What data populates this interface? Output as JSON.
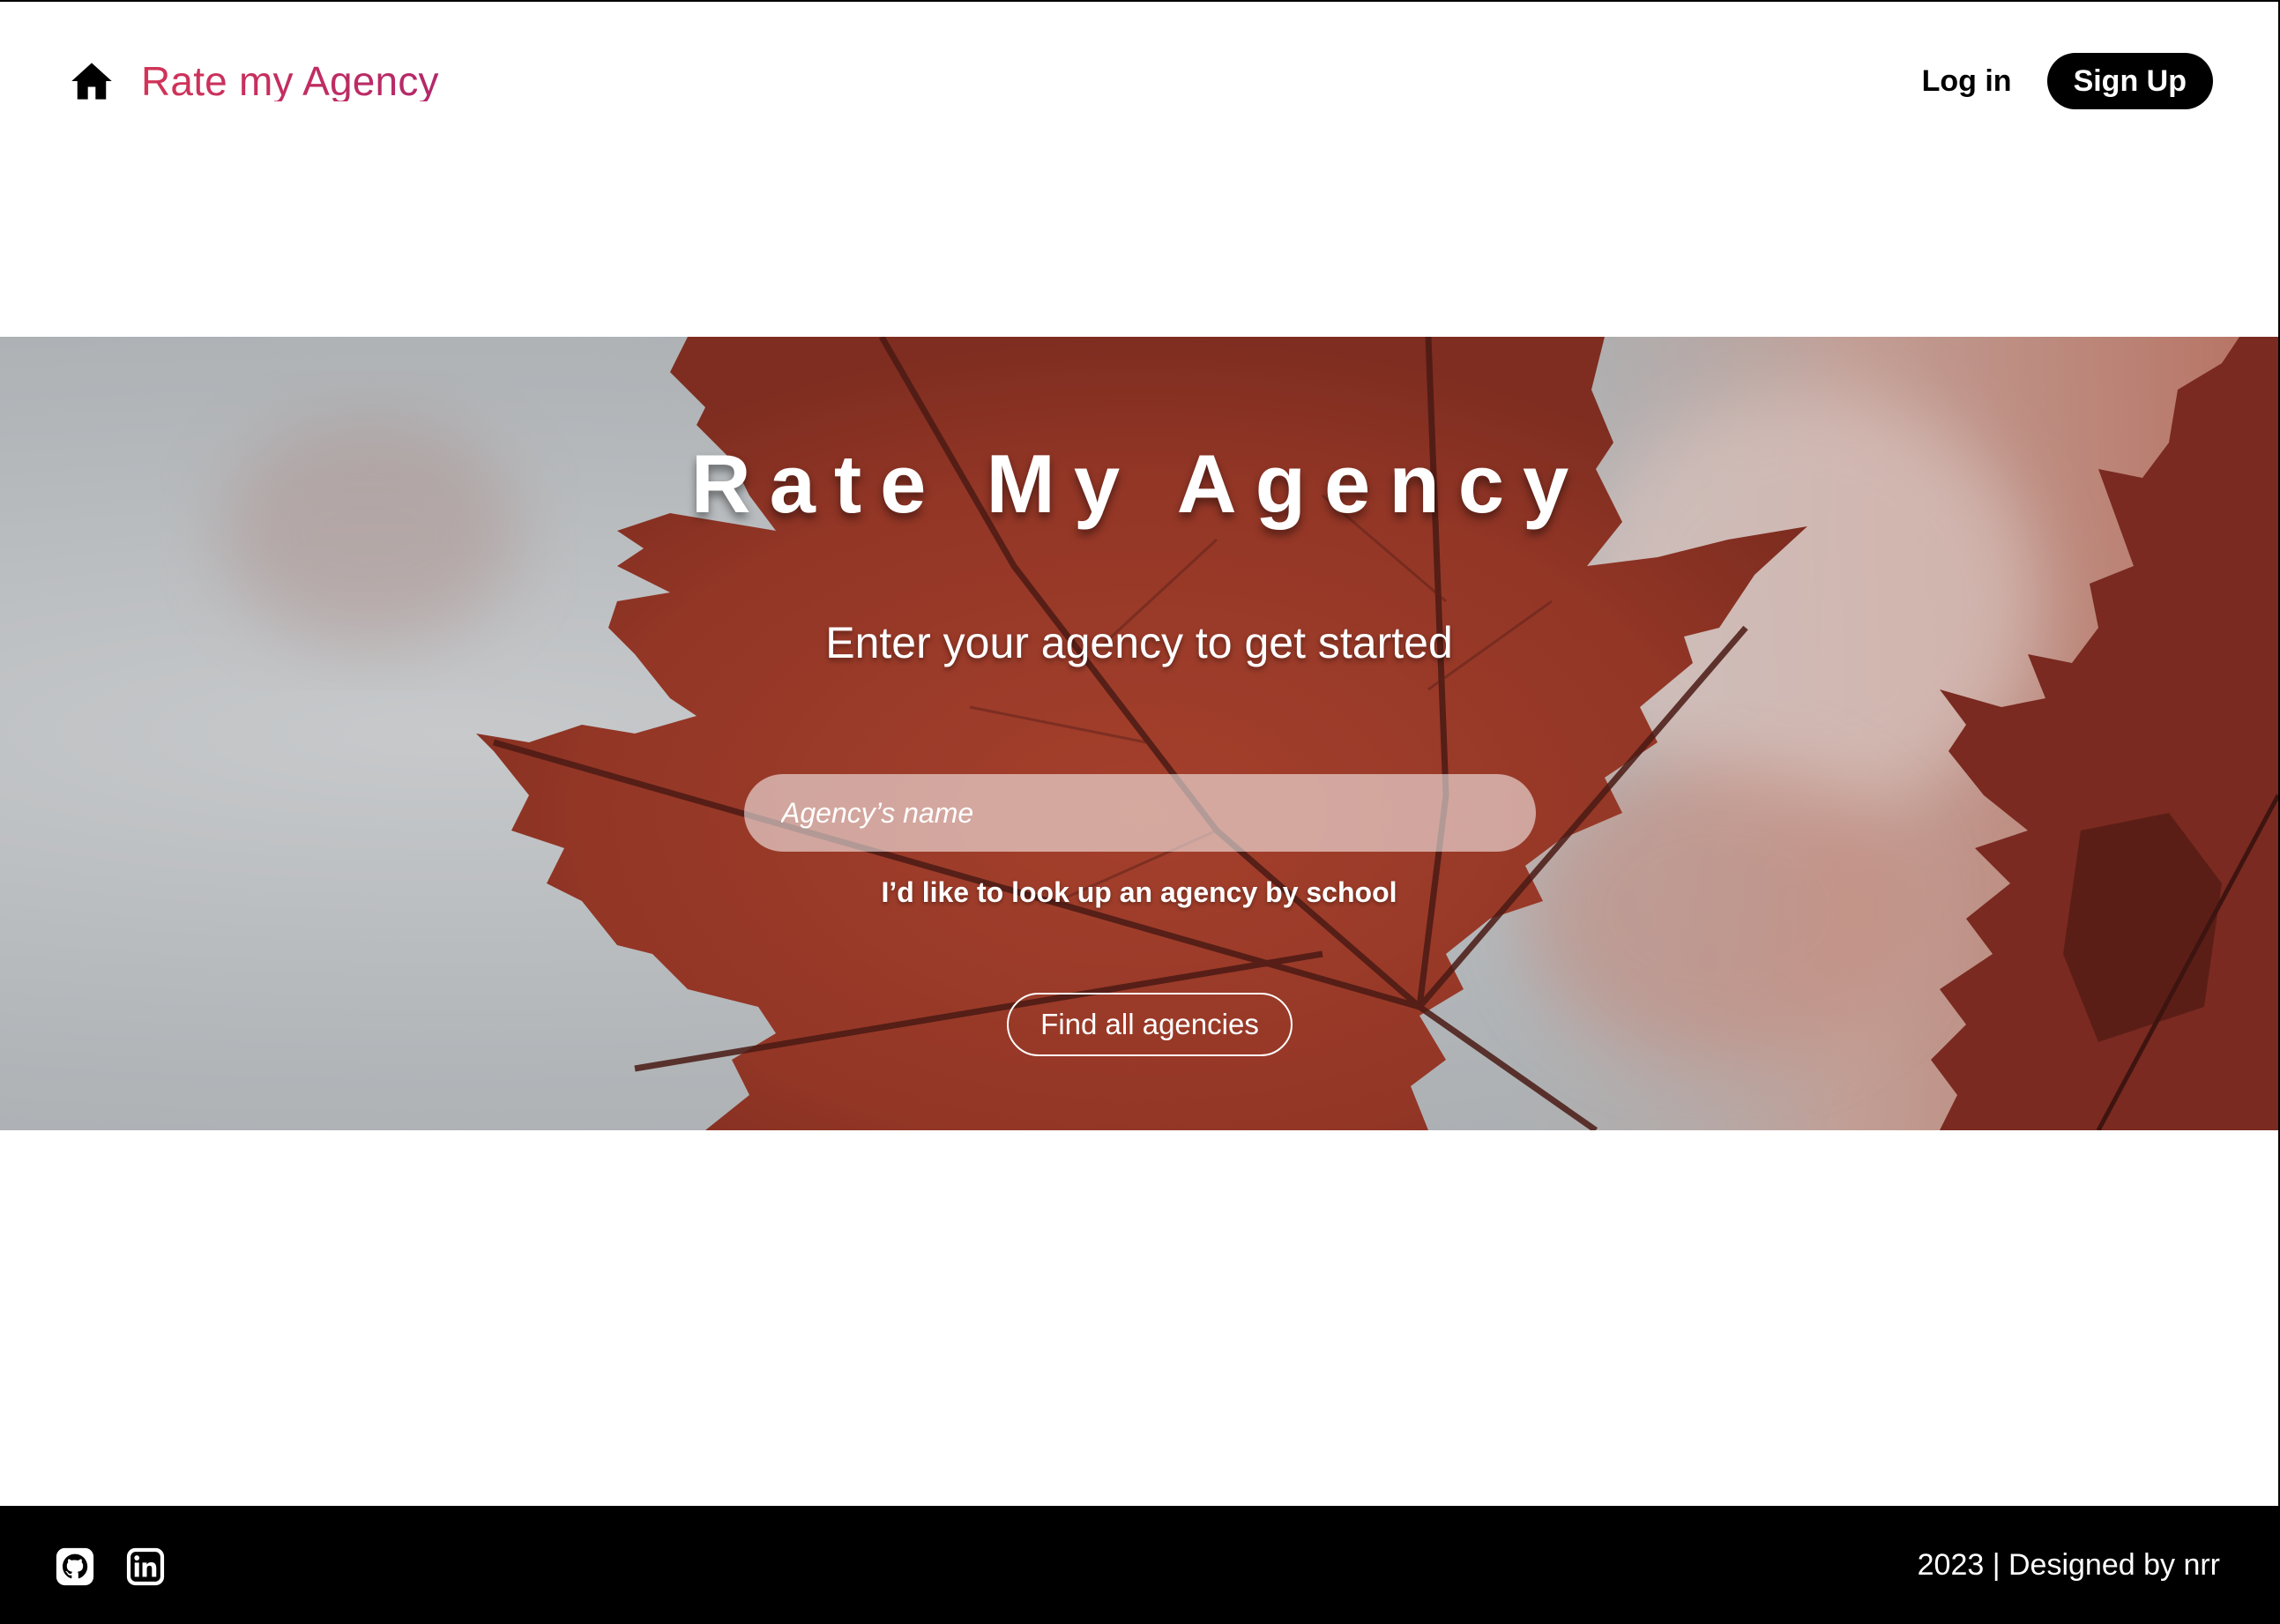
{
  "header": {
    "brand_title": "Rate my Agency",
    "home_icon": "home-icon",
    "login_label": "Log in",
    "signup_label": "Sign Up"
  },
  "hero": {
    "title": "Rate My Agency",
    "subtitle": "Enter your agency to get started",
    "search_placeholder": "Agency’s name",
    "search_value": "",
    "school_link": "I’d like to look up an agency by school",
    "find_all_label": "Find all agencies",
    "background": "maple-leaf-photo"
  },
  "footer": {
    "icons": [
      "github-icon",
      "linkedin-icon"
    ],
    "credit": "2023 | Designed by nrr"
  },
  "colors": {
    "brand_gradient_start": "#d23457",
    "brand_gradient_end": "#b3286a",
    "signup_bg": "#000000",
    "footer_bg": "#000000",
    "leaf": "#9a3a2a"
  }
}
